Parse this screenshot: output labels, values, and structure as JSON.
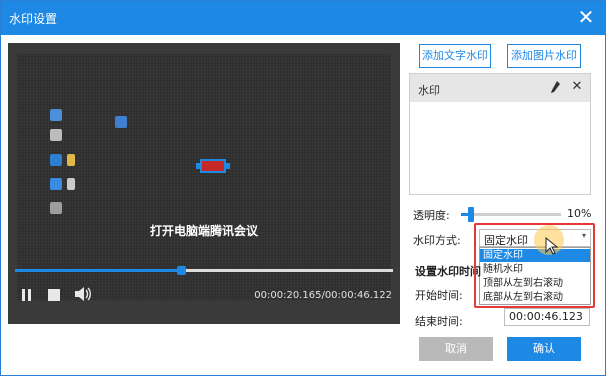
{
  "window": {
    "title": "水印设置"
  },
  "player": {
    "caption": "打开电脑端腾讯会议",
    "progress_fraction": 0.44,
    "time_display": "00:00:20.165/00:00:46.122"
  },
  "right": {
    "add_text_button": "添加文字水印",
    "add_image_button": "添加图片水印",
    "list_header": "水印",
    "opacity_label": "透明度:",
    "opacity_value": "10%",
    "opacity_fraction": 0.1,
    "mode_label": "水印方式:",
    "mode_selected": "固定水印",
    "mode_options": [
      "固定水印",
      "随机水印",
      "顶部从左到右滚动",
      "底部从左到右滚动"
    ],
    "time_section_label": "设置水印时间",
    "start_label": "开始时间:",
    "end_label": "结束时间:",
    "end_value": "00:00:46.123",
    "cancel_button": "取消",
    "ok_button": "确认"
  },
  "colors": {
    "accent": "#1e88e5",
    "highlight": "#e53935"
  }
}
